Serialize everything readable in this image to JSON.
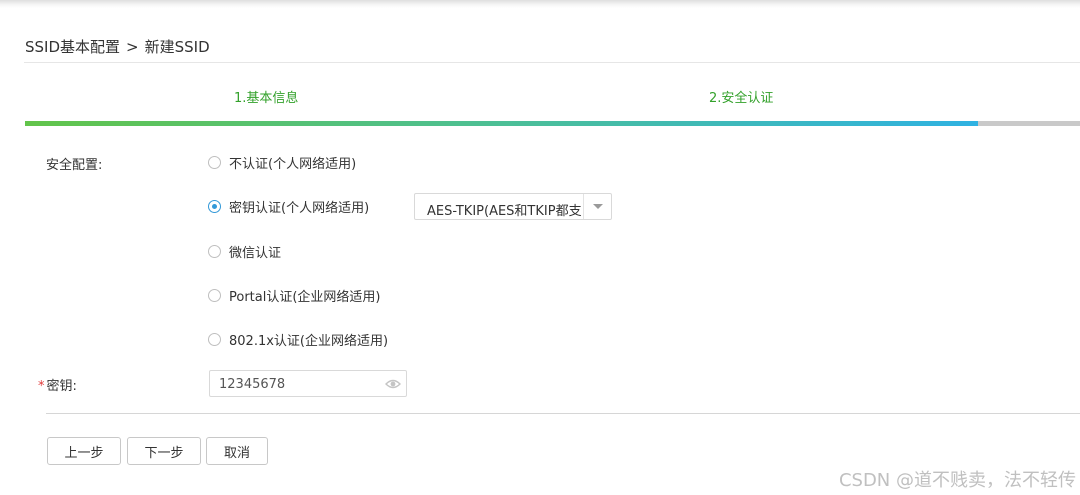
{
  "breadcrumb": {
    "parent": "SSID基本配置",
    "separator": ">",
    "current": "新建SSID"
  },
  "steps": [
    {
      "label": "1.基本信息"
    },
    {
      "label": "2.安全认证"
    }
  ],
  "progress": {
    "completed_fraction": 0.903
  },
  "form": {
    "security_label": "安全配置:",
    "auth_options": [
      {
        "label": "不认证(个人网络适用)",
        "checked": false
      },
      {
        "label": "密钥认证(个人网络适用)",
        "checked": true
      },
      {
        "label": "微信认证",
        "checked": false
      },
      {
        "label": "Portal认证(企业网络适用)",
        "checked": false
      },
      {
        "label": "802.1x认证(企业网络适用)",
        "checked": false
      }
    ],
    "encryption_select": {
      "selected": "AES-TKIP(AES和TKIP都支"
    },
    "key_field": {
      "required_mark": "*",
      "label": "密钥:",
      "value": "12345678",
      "icon": "eye-icon"
    }
  },
  "buttons": {
    "prev": "上一步",
    "next": "下一步",
    "cancel": "取消"
  },
  "watermark": "CSDN @道不贱卖，法不轻传",
  "colors": {
    "step_text": "#33a12b",
    "progress_start": "#62c44a",
    "progress_end": "#2fb2e2",
    "radio_checked": "#3399d8",
    "required": "#e03a3a"
  }
}
